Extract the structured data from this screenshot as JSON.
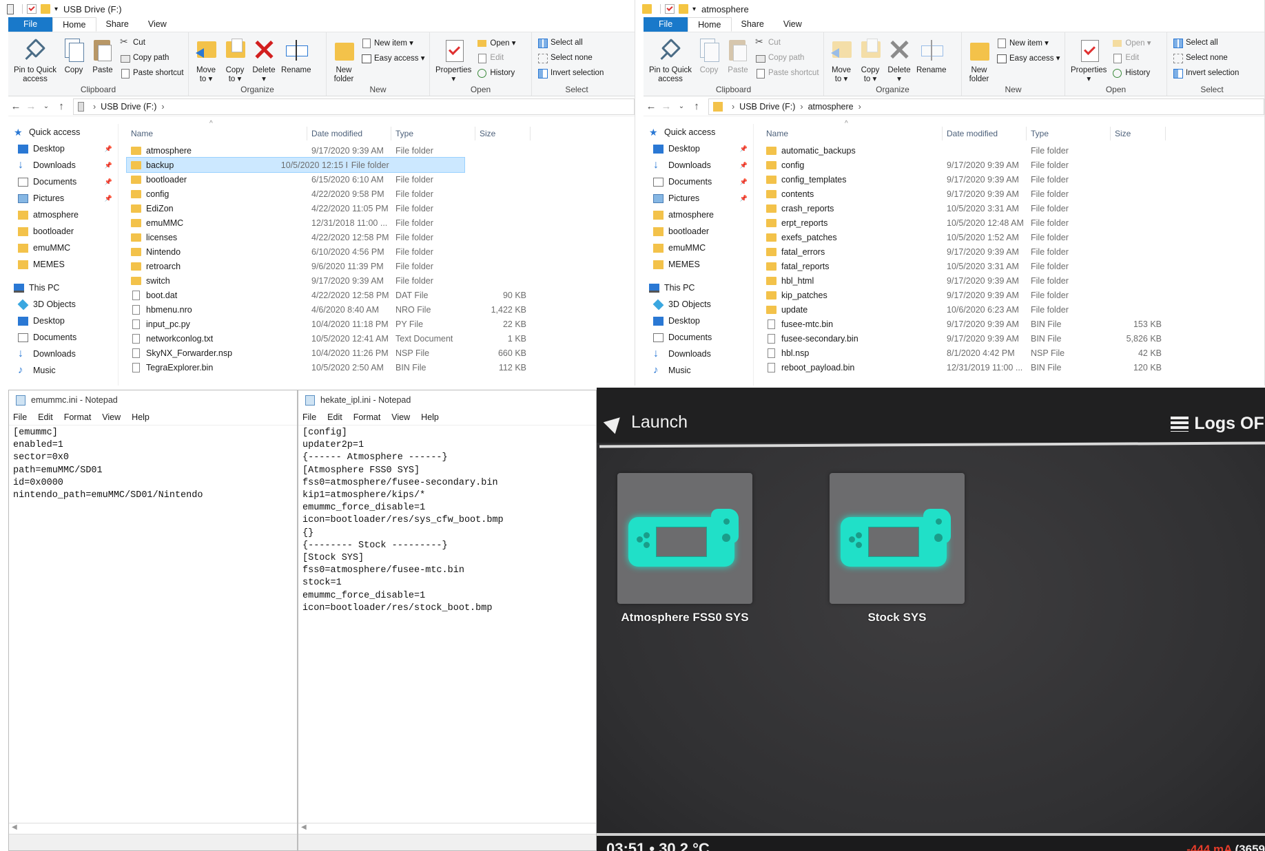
{
  "explorer_left": {
    "title": "USB Drive (F:)",
    "tabs": [
      "File",
      "Home",
      "Share",
      "View"
    ],
    "ribbon": {
      "pin_label": "Pin to Quick\naccess",
      "copy_label": "Copy",
      "paste_label": "Paste",
      "cut": "Cut",
      "copy_path": "Copy path",
      "paste_shortcut": "Paste shortcut",
      "clipboard_group": "Clipboard",
      "move_to": "Move\nto ▾",
      "copy_to": "Copy\nto ▾",
      "delete": "Delete\n▾",
      "rename": "Rename",
      "organize_group": "Organize",
      "new_folder": "New\nfolder",
      "new_item": "New item ▾",
      "easy_access": "Easy access ▾",
      "new_group": "New",
      "properties": "Properties\n▾",
      "open": "Open ▾",
      "edit": "Edit",
      "history": "History",
      "open_group": "Open",
      "select_all": "Select all",
      "select_none": "Select none",
      "invert_selection": "Invert selection",
      "select_group": "Select"
    },
    "breadcrumb": [
      "USB Drive (F:)"
    ],
    "columns": {
      "name": "Name",
      "date": "Date modified",
      "type": "Type",
      "size": "Size"
    },
    "files": [
      {
        "name": "atmosphere",
        "date": "9/17/2020 9:39 AM",
        "type": "File folder",
        "size": "",
        "kind": "folder"
      },
      {
        "name": "backup",
        "date": "10/5/2020 12:15 PM",
        "type": "File folder",
        "size": "",
        "kind": "folder",
        "selected": true
      },
      {
        "name": "bootloader",
        "date": "6/15/2020 6:10 AM",
        "type": "File folder",
        "size": "",
        "kind": "folder"
      },
      {
        "name": "config",
        "date": "4/22/2020 9:58 PM",
        "type": "File folder",
        "size": "",
        "kind": "folder"
      },
      {
        "name": "EdiZon",
        "date": "4/22/2020 11:05 PM",
        "type": "File folder",
        "size": "",
        "kind": "folder"
      },
      {
        "name": "emuMMC",
        "date": "12/31/2018 11:00 ...",
        "type": "File folder",
        "size": "",
        "kind": "folder"
      },
      {
        "name": "licenses",
        "date": "4/22/2020 12:58 PM",
        "type": "File folder",
        "size": "",
        "kind": "folder"
      },
      {
        "name": "Nintendo",
        "date": "6/10/2020 4:56 PM",
        "type": "File folder",
        "size": "",
        "kind": "folder"
      },
      {
        "name": "retroarch",
        "date": "9/6/2020 11:39 PM",
        "type": "File folder",
        "size": "",
        "kind": "folder"
      },
      {
        "name": "switch",
        "date": "9/17/2020 9:39 AM",
        "type": "File folder",
        "size": "",
        "kind": "folder"
      },
      {
        "name": "boot.dat",
        "date": "4/22/2020 12:58 PM",
        "type": "DAT File",
        "size": "90 KB",
        "kind": "file"
      },
      {
        "name": "hbmenu.nro",
        "date": "4/6/2020 8:40 AM",
        "type": "NRO File",
        "size": "1,422 KB",
        "kind": "file"
      },
      {
        "name": "input_pc.py",
        "date": "10/4/2020 11:18 PM",
        "type": "PY File",
        "size": "22 KB",
        "kind": "file"
      },
      {
        "name": "networkconlog.txt",
        "date": "10/5/2020 12:41 AM",
        "type": "Text Document",
        "size": "1 KB",
        "kind": "file"
      },
      {
        "name": "SkyNX_Forwarder.nsp",
        "date": "10/4/2020 11:26 PM",
        "type": "NSP File",
        "size": "660 KB",
        "kind": "file"
      },
      {
        "name": "TegraExplorer.bin",
        "date": "10/5/2020 2:50 AM",
        "type": "BIN File",
        "size": "112 KB",
        "kind": "file"
      }
    ]
  },
  "explorer_right": {
    "title": "atmosphere",
    "tabs": [
      "File",
      "Home",
      "Share",
      "View"
    ],
    "breadcrumb": [
      "USB Drive (F:)",
      "atmosphere"
    ],
    "files": [
      {
        "name": "automatic_backups",
        "date": "",
        "type": "File folder",
        "size": "",
        "kind": "folder"
      },
      {
        "name": "config",
        "date": "9/17/2020 9:39 AM",
        "type": "File folder",
        "size": "",
        "kind": "folder"
      },
      {
        "name": "config_templates",
        "date": "9/17/2020 9:39 AM",
        "type": "File folder",
        "size": "",
        "kind": "folder"
      },
      {
        "name": "contents",
        "date": "9/17/2020 9:39 AM",
        "type": "File folder",
        "size": "",
        "kind": "folder"
      },
      {
        "name": "crash_reports",
        "date": "10/5/2020 3:31 AM",
        "type": "File folder",
        "size": "",
        "kind": "folder"
      },
      {
        "name": "erpt_reports",
        "date": "10/5/2020 12:48 AM",
        "type": "File folder",
        "size": "",
        "kind": "folder"
      },
      {
        "name": "exefs_patches",
        "date": "10/5/2020 1:52 AM",
        "type": "File folder",
        "size": "",
        "kind": "folder"
      },
      {
        "name": "fatal_errors",
        "date": "9/17/2020 9:39 AM",
        "type": "File folder",
        "size": "",
        "kind": "folder"
      },
      {
        "name": "fatal_reports",
        "date": "10/5/2020 3:31 AM",
        "type": "File folder",
        "size": "",
        "kind": "folder"
      },
      {
        "name": "hbl_html",
        "date": "9/17/2020 9:39 AM",
        "type": "File folder",
        "size": "",
        "kind": "folder"
      },
      {
        "name": "kip_patches",
        "date": "9/17/2020 9:39 AM",
        "type": "File folder",
        "size": "",
        "kind": "folder"
      },
      {
        "name": "update",
        "date": "10/6/2020 6:23 AM",
        "type": "File folder",
        "size": "",
        "kind": "folder"
      },
      {
        "name": "fusee-mtc.bin",
        "date": "9/17/2020 9:39 AM",
        "type": "BIN File",
        "size": "153 KB",
        "kind": "file"
      },
      {
        "name": "fusee-secondary.bin",
        "date": "9/17/2020 9:39 AM",
        "type": "BIN File",
        "size": "5,826 KB",
        "kind": "file"
      },
      {
        "name": "hbl.nsp",
        "date": "8/1/2020 4:42 PM",
        "type": "NSP File",
        "size": "42 KB",
        "kind": "file"
      },
      {
        "name": "reboot_payload.bin",
        "date": "12/31/2019 11:00 ...",
        "type": "BIN File",
        "size": "120 KB",
        "kind": "file"
      }
    ]
  },
  "navpane": [
    {
      "label": "Quick access",
      "icon": "star",
      "pinned": false,
      "group": true
    },
    {
      "label": "Desktop",
      "icon": "desk",
      "pinned": true
    },
    {
      "label": "Downloads",
      "icon": "down",
      "pinned": true
    },
    {
      "label": "Documents",
      "icon": "doc",
      "pinned": true
    },
    {
      "label": "Pictures",
      "icon": "pic",
      "pinned": true
    },
    {
      "label": "atmosphere",
      "icon": "fold",
      "pinned": false
    },
    {
      "label": "bootloader",
      "icon": "fold",
      "pinned": false
    },
    {
      "label": "emuMMC",
      "icon": "fold",
      "pinned": false
    },
    {
      "label": "MEMES",
      "icon": "fold",
      "pinned": false
    },
    {
      "label": "",
      "icon": "",
      "pinned": false,
      "spacer": true
    },
    {
      "label": "This PC",
      "icon": "pc",
      "pinned": false,
      "group": true
    },
    {
      "label": "3D Objects",
      "icon": "obj",
      "pinned": false
    },
    {
      "label": "Desktop",
      "icon": "desk",
      "pinned": false
    },
    {
      "label": "Documents",
      "icon": "doc",
      "pinned": false
    },
    {
      "label": "Downloads",
      "icon": "down",
      "pinned": false
    },
    {
      "label": "Music",
      "icon": "music",
      "pinned": false
    }
  ],
  "notepad_left": {
    "title": "emummc.ini - Notepad",
    "menu": [
      "File",
      "Edit",
      "Format",
      "View",
      "Help"
    ],
    "text": "[emummc]\nenabled=1\nsector=0x0\npath=emuMMC/SD01\nid=0x0000\nnintendo_path=emuMMC/SD01/Nintendo"
  },
  "notepad_right": {
    "title": "hekate_ipl.ini - Notepad",
    "menu": [
      "File",
      "Edit",
      "Format",
      "View",
      "Help"
    ],
    "text": "[config]\nupdater2p=1\n{------ Atmosphere ------}\n[Atmosphere FSS0 SYS]\nfss0=atmosphere/fusee-secondary.bin\nkip1=atmosphere/kips/*\nemummc_force_disable=1\nicon=bootloader/res/sys_cfw_boot.bmp\n{}\n{-------- Stock ---------}\n[Stock SYS]\nfss0=atmosphere/fusee-mtc.bin\nstock=1\nemummc_force_disable=1\nicon=bootloader/res/stock_boot.bmp"
  },
  "hekate": {
    "launch": "Launch",
    "logs": "Logs OFF",
    "entries": [
      "Atmosphere FSS0 SYS",
      "Stock SYS"
    ],
    "status": "03:51 • 30.2 °C",
    "current": "-444 mA",
    "battery": "(3659"
  },
  "colors": {
    "accent": "#1979ca",
    "selected_row": "#cce8ff",
    "folder": "#f3c24a",
    "console": "#20e0c8"
  }
}
